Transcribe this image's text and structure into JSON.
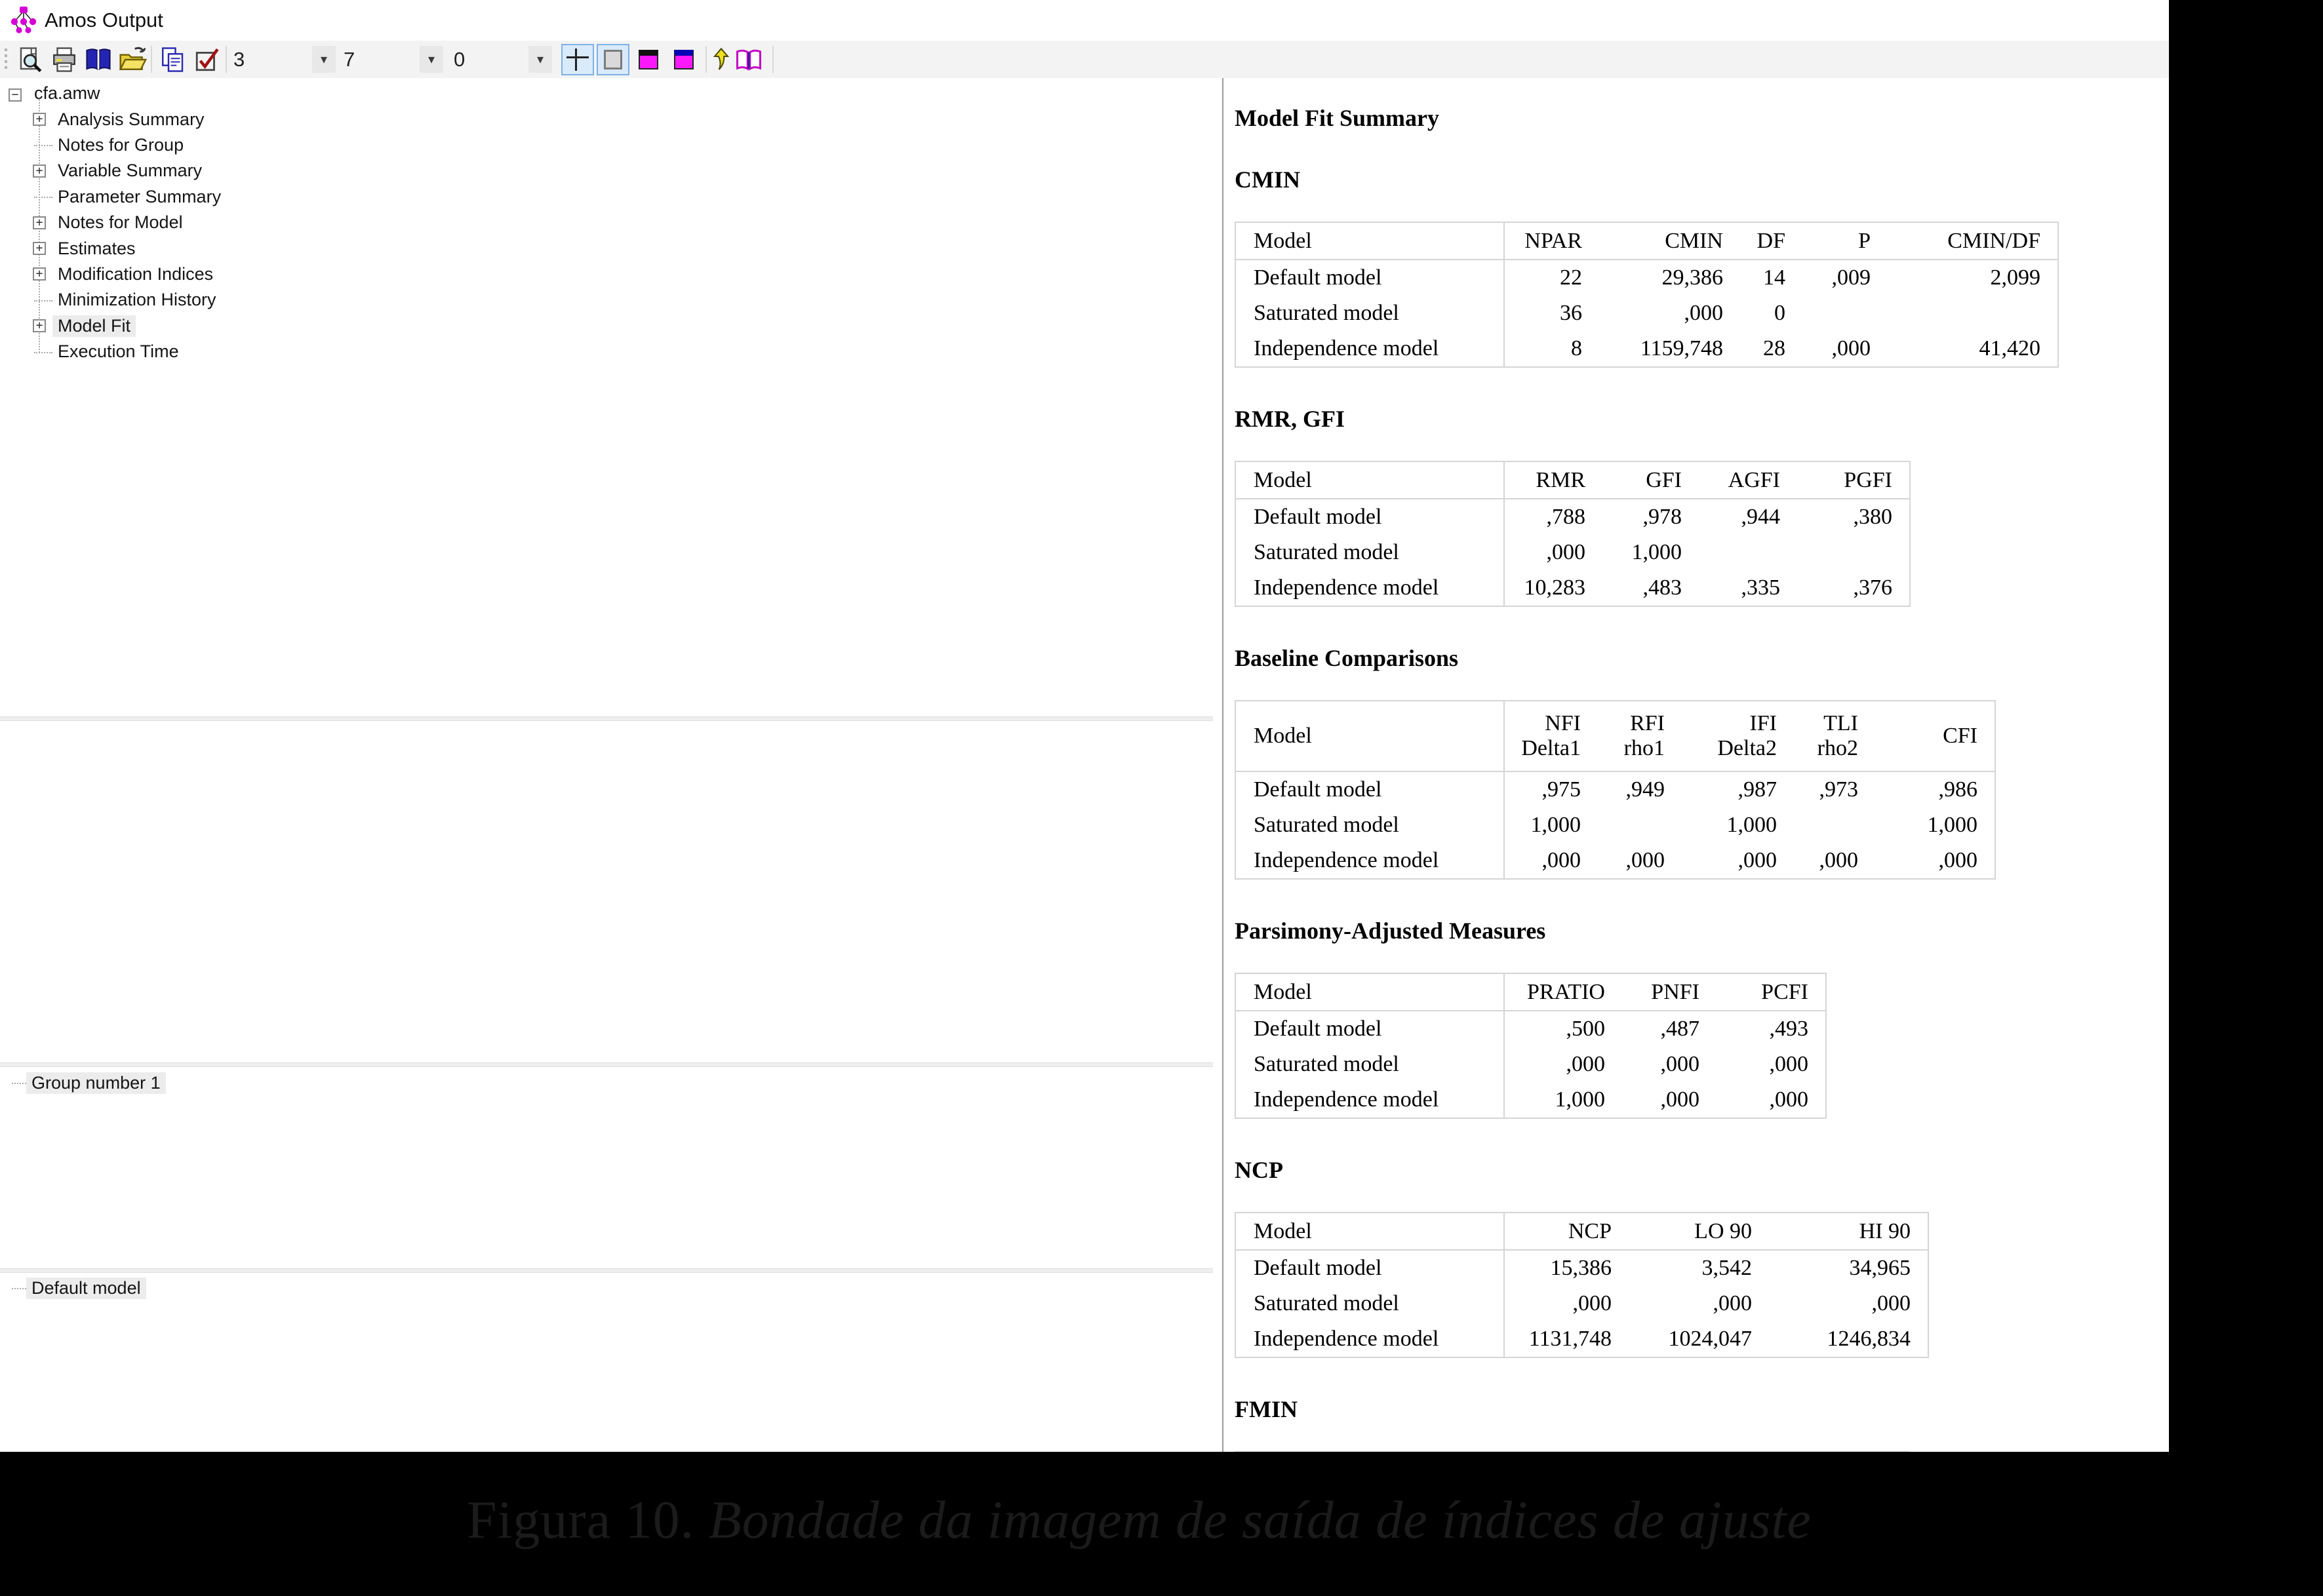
{
  "window": {
    "title": "Amos Output"
  },
  "toolbar": {
    "icons": [
      "print-preview-icon",
      "print-icon",
      "help-book-icon",
      "open-folder-icon",
      "copy-icon",
      "options-checkbox-icon"
    ],
    "combos": [
      {
        "value": "3"
      },
      {
        "value": "7"
      },
      {
        "value": "0"
      }
    ],
    "toggles": [
      "table-grid-toggle",
      "plain-page-toggle",
      "magenta-black-style",
      "magenta-blue-style"
    ],
    "extra_icons": [
      "yellow-arrow-icon",
      "open-book-icon"
    ]
  },
  "sidebar": {
    "root": "cfa.amw",
    "items": [
      {
        "label": "Analysis Summary",
        "expandable": true,
        "selected": false
      },
      {
        "label": "Notes for Group",
        "expandable": false,
        "selected": false
      },
      {
        "label": "Variable Summary",
        "expandable": true,
        "selected": false
      },
      {
        "label": "Parameter Summary",
        "expandable": false,
        "selected": false
      },
      {
        "label": "Notes for Model",
        "expandable": true,
        "selected": false
      },
      {
        "label": "Estimates",
        "expandable": true,
        "selected": false
      },
      {
        "label": "Modification Indices",
        "expandable": true,
        "selected": false
      },
      {
        "label": "Minimization History",
        "expandable": false,
        "selected": false
      },
      {
        "label": "Model Fit",
        "expandable": true,
        "selected": true
      },
      {
        "label": "Execution Time",
        "expandable": false,
        "selected": false
      }
    ],
    "group_label": "Group number 1",
    "model_label": "Default model"
  },
  "output": {
    "title": "Model Fit Summary",
    "sections": [
      {
        "heading": "CMIN",
        "table": {
          "headers": [
            "Model",
            "NPAR",
            "CMIN",
            "DF",
            "P",
            "CMIN/DF"
          ],
          "rows": [
            [
              "Default model",
              "22",
              "29,386",
              "14",
              ",009",
              "2,099"
            ],
            [
              "Saturated model",
              "36",
              ",000",
              "0",
              "",
              ""
            ],
            [
              "Independence model",
              "8",
              "1159,748",
              "28",
              ",000",
              "41,420"
            ]
          ]
        }
      },
      {
        "heading": "RMR, GFI",
        "table": {
          "headers": [
            "Model",
            "RMR",
            "GFI",
            "AGFI",
            "PGFI"
          ],
          "rows": [
            [
              "Default model",
              ",788",
              ",978",
              ",944",
              ",380"
            ],
            [
              "Saturated model",
              ",000",
              "1,000",
              "",
              ""
            ],
            [
              "Independence model",
              "10,283",
              ",483",
              ",335",
              ",376"
            ]
          ]
        }
      },
      {
        "heading": "Baseline Comparisons",
        "table": {
          "headers": [
            "Model",
            "NFI\nDelta1",
            "RFI\nrho1",
            "IFI\nDelta2",
            "TLI\nrho2",
            "CFI"
          ],
          "rows": [
            [
              "Default model",
              ",975",
              ",949",
              ",987",
              ",973",
              ",986"
            ],
            [
              "Saturated model",
              "1,000",
              "",
              "1,000",
              "",
              "1,000"
            ],
            [
              "Independence model",
              ",000",
              ",000",
              ",000",
              ",000",
              ",000"
            ]
          ]
        }
      },
      {
        "heading": "Parsimony-Adjusted Measures",
        "table": {
          "headers": [
            "Model",
            "PRATIO",
            "PNFI",
            "PCFI"
          ],
          "rows": [
            [
              "Default model",
              ",500",
              ",487",
              ",493"
            ],
            [
              "Saturated model",
              ",000",
              ",000",
              ",000"
            ],
            [
              "Independence model",
              "1,000",
              ",000",
              ",000"
            ]
          ]
        }
      },
      {
        "heading": "NCP",
        "table": {
          "headers": [
            "Model",
            "NCP",
            "LO 90",
            "HI 90"
          ],
          "rows": [
            [
              "Default model",
              "15,386",
              "3,542",
              "34,965"
            ],
            [
              "Saturated model",
              ",000",
              ",000",
              ",000"
            ],
            [
              "Independence model",
              "1131,748",
              "1024,047",
              "1246,834"
            ]
          ]
        }
      },
      {
        "heading": "FMIN",
        "table": {
          "headers": [],
          "rows": [],
          "truncated": true
        }
      }
    ]
  },
  "caption": {
    "label": "Figura 10.",
    "text": " Bondade da imagem de saída de índices de ajuste"
  }
}
